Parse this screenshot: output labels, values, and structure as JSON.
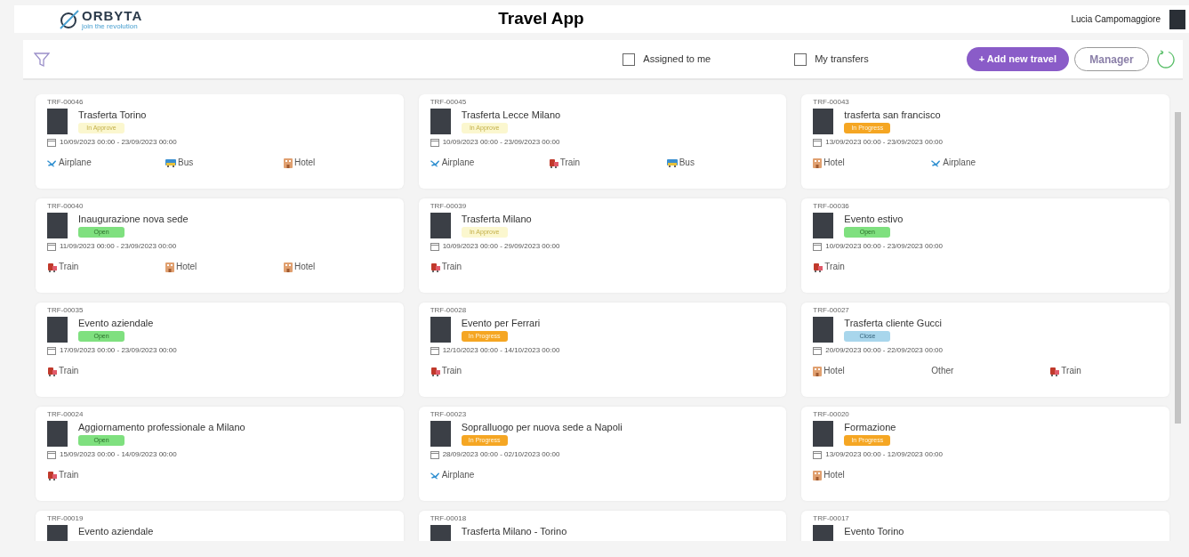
{
  "header": {
    "logo": "ORBYTA",
    "tagline": "join the revolution",
    "title": "Travel App",
    "user": "Lucia Campomaggiore"
  },
  "toolbar": {
    "filters": [
      {
        "label": "Assigned to me",
        "checked": false
      },
      {
        "label": "My transfers",
        "checked": false
      }
    ],
    "add_button": "+ Add new travel",
    "role_button": "Manager"
  },
  "travels": [
    {
      "code": "TRF-00046",
      "title": "Trasferta Torino",
      "status": {
        "kind": "approve",
        "label": "In Approve"
      },
      "dates": "10/09/2023 00:00 - 23/09/2023 00:00",
      "transports": [
        {
          "kind": "airplane",
          "label": "Airplane"
        },
        {
          "kind": "bus",
          "label": "Bus"
        },
        {
          "kind": "hotel",
          "label": "Hotel"
        }
      ]
    },
    {
      "code": "TRF-00045",
      "title": "Trasferta Lecce Milano",
      "status": {
        "kind": "approve",
        "label": "In Approve"
      },
      "dates": "10/09/2023 00:00 - 23/09/2023 00:00",
      "transports": [
        {
          "kind": "airplane",
          "label": "Airplane"
        },
        {
          "kind": "train",
          "label": "Train"
        },
        {
          "kind": "bus",
          "label": "Bus"
        }
      ]
    },
    {
      "code": "TRF-00043",
      "title": "trasferta san francisco",
      "status": {
        "kind": "progress",
        "label": "In Progress"
      },
      "dates": "13/09/2023 00:00 - 23/09/2023 00:00",
      "transports": [
        {
          "kind": "hotel",
          "label": "Hotel"
        },
        {
          "kind": "airplane",
          "label": "Airplane"
        }
      ]
    },
    {
      "code": "TRF-00040",
      "title": "Inaugurazione nova sede",
      "status": {
        "kind": "open",
        "label": "Open"
      },
      "dates": "11/09/2023 00:00 - 23/09/2023 00:00",
      "transports": [
        {
          "kind": "train",
          "label": "Train"
        },
        {
          "kind": "hotel",
          "label": "Hotel"
        },
        {
          "kind": "hotel",
          "label": "Hotel"
        }
      ]
    },
    {
      "code": "TRF-00039",
      "title": "Trasferta Milano",
      "status": {
        "kind": "approve",
        "label": "In Approve"
      },
      "dates": "10/09/2023 00:00 - 29/09/2023 00:00",
      "transports": [
        {
          "kind": "train",
          "label": "Train"
        }
      ]
    },
    {
      "code": "TRF-00036",
      "title": "Evento estivo",
      "status": {
        "kind": "open",
        "label": "Open"
      },
      "dates": "10/09/2023 00:00 - 23/09/2023 00:00",
      "transports": [
        {
          "kind": "train",
          "label": "Train"
        }
      ]
    },
    {
      "code": "TRF-00035",
      "title": "Evento aziendale",
      "status": {
        "kind": "open",
        "label": "Open"
      },
      "dates": "17/09/2023 00:00 - 23/09/2023 00:00",
      "transports": [
        {
          "kind": "train",
          "label": "Train"
        }
      ]
    },
    {
      "code": "TRF-00028",
      "title": "Evento per Ferrari",
      "status": {
        "kind": "progress",
        "label": "In Progress"
      },
      "dates": "12/10/2023 00:00 - 14/10/2023 00:00",
      "transports": [
        {
          "kind": "train",
          "label": "Train"
        }
      ]
    },
    {
      "code": "TRF-00027",
      "title": "Trasferta cliente Gucci",
      "status": {
        "kind": "close",
        "label": "Close"
      },
      "dates": "20/09/2023 00:00 - 22/09/2023 00:00",
      "transports": [
        {
          "kind": "hotel",
          "label": "Hotel"
        },
        {
          "kind": "other",
          "label": "Other"
        },
        {
          "kind": "train",
          "label": "Train"
        }
      ]
    },
    {
      "code": "TRF-00024",
      "title": "Aggiornamento professionale a Milano",
      "status": {
        "kind": "open",
        "label": "Open"
      },
      "dates": "15/09/2023 00:00 - 14/09/2023 00:00",
      "transports": [
        {
          "kind": "train",
          "label": "Train"
        }
      ]
    },
    {
      "code": "TRF-00023",
      "title": "Sopralluogo per nuova sede a Napoli",
      "status": {
        "kind": "progress",
        "label": "In Progress"
      },
      "dates": "28/09/2023 00:00 - 02/10/2023 00:00",
      "transports": [
        {
          "kind": "airplane",
          "label": "Airplane"
        }
      ]
    },
    {
      "code": "TRF-00020",
      "title": "Formazione",
      "status": {
        "kind": "progress",
        "label": "In Progress"
      },
      "dates": "13/09/2023 00:00 - 12/09/2023 00:00",
      "transports": [
        {
          "kind": "hotel",
          "label": "Hotel"
        }
      ]
    },
    {
      "code": "TRF-00019",
      "title": "Evento aziendale"
    },
    {
      "code": "TRF-00018",
      "title": "Trasferta Milano - Torino"
    },
    {
      "code": "TRF-00017",
      "title": "Evento Torino"
    }
  ]
}
